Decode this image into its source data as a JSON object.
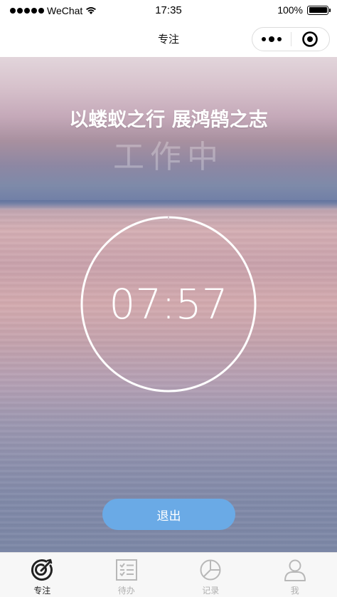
{
  "status_bar": {
    "carrier": "WeChat",
    "time": "17:35",
    "battery": "100%",
    "battery_level": 1.0
  },
  "nav": {
    "title": "专注"
  },
  "main": {
    "motto": "以蝼蚁之行 展鸿鹄之志",
    "status": "工作中",
    "timer": "07:57",
    "exit_label": "退出"
  },
  "tabs": [
    {
      "label": "专注",
      "icon": "target-icon",
      "active": true
    },
    {
      "label": "待办",
      "icon": "checklist-icon",
      "active": false
    },
    {
      "label": "记录",
      "icon": "pie-chart-icon",
      "active": false
    },
    {
      "label": "我",
      "icon": "user-icon",
      "active": false
    }
  ],
  "colors": {
    "accent": "#6aaae6",
    "tab_active": "#222222",
    "tab_inactive": "#b0b0b0"
  }
}
